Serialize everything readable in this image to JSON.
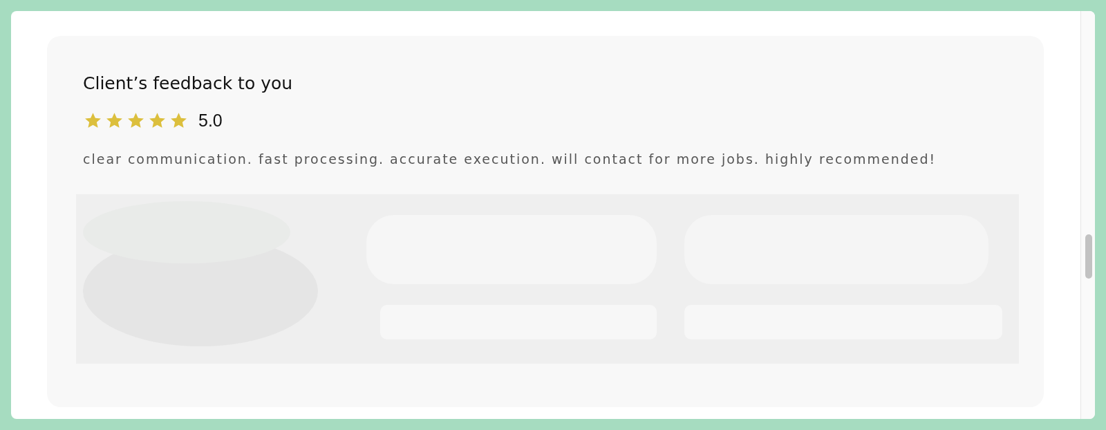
{
  "feedback": {
    "title": "Client’s feedback to you",
    "stars": 5,
    "rating": "5.0",
    "comment": "clear communication. fast processing. accurate execution. will contact for more jobs. highly recommended!"
  }
}
